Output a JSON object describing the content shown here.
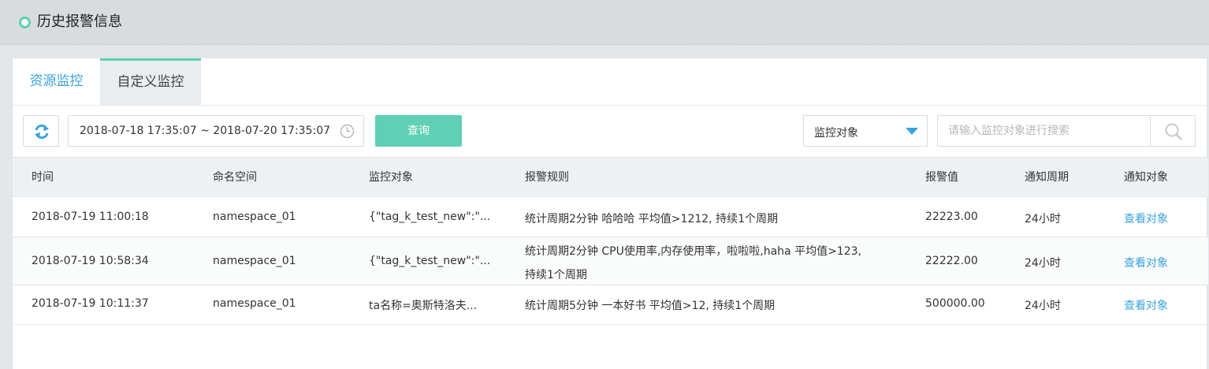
{
  "header": {
    "title": "历史报警信息"
  },
  "tabs": [
    {
      "label": "资源监控"
    },
    {
      "label": "自定义监控"
    }
  ],
  "toolbar": {
    "date_range": "2018-07-18 17:35:07 ~ 2018-07-20 17:35:07",
    "query_label": "查询",
    "select_value": "监控对象",
    "search_placeholder": "请输入监控对象进行搜索"
  },
  "table": {
    "columns": [
      "时间",
      "命名空间",
      "监控对象",
      "报警规则",
      "报警值",
      "通知周期",
      "通知对象"
    ],
    "rows": [
      {
        "time": "2018-07-19 11:00:18",
        "namespace": "namespace_01",
        "object": "{\"tag_k_test_new\":\"...",
        "rule": "统计周期2分钟 哈哈哈 平均值>1212, 持续1个周期",
        "rule_line2": "",
        "value": "22223.00",
        "period": "24小时",
        "action": "查看对象"
      },
      {
        "time": "2018-07-19 10:58:34",
        "namespace": "namespace_01",
        "object": "{\"tag_k_test_new\":\"...",
        "rule": "统计周期2分钟 CPU使用率,内存使用率，啦啦啦,haha 平均值>123,",
        "rule_line2": "持续1个周期",
        "value": "22222.00",
        "period": "24小时",
        "action": "查看对象"
      },
      {
        "time": "2018-07-19 10:11:37",
        "namespace": "namespace_01",
        "object": "ta名称=奥斯特洛夫...",
        "rule": "统计周期5分钟 一本好书 平均值>12, 持续1个周期",
        "rule_line2": "",
        "value": "500000.00",
        "period": "24小时",
        "action": "查看对象"
      }
    ]
  },
  "icons": {
    "header_dot": "status-dot-icon",
    "refresh": "refresh-icon",
    "clock": "clock-icon",
    "caret": "caret-down-icon",
    "search": "search-icon"
  },
  "colors": {
    "accent": "#5fd0b3",
    "link": "#3aa3dc"
  }
}
